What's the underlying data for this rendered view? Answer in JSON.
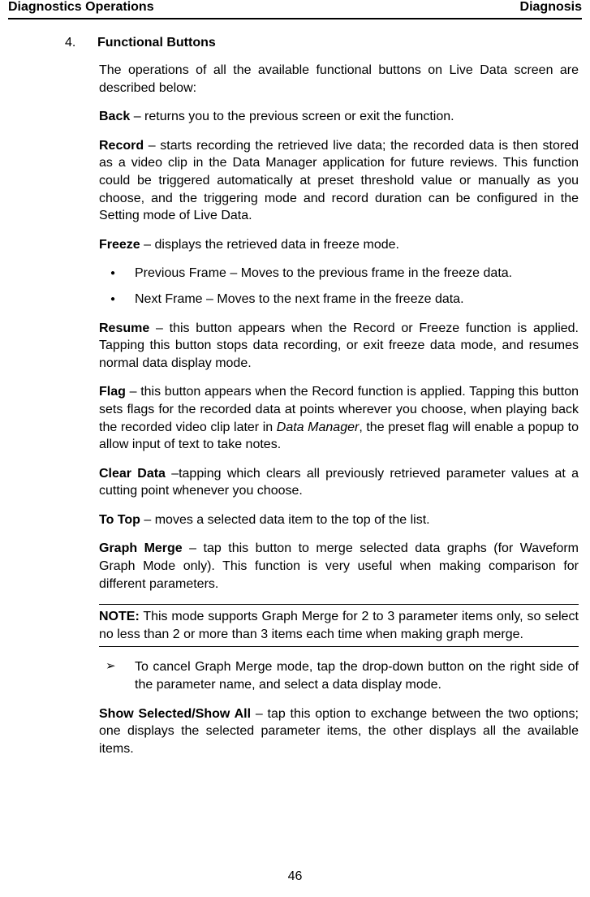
{
  "header": {
    "left": "Diagnostics Operations",
    "right": "Diagnosis"
  },
  "section": {
    "number": "4.",
    "title": "Functional Buttons"
  },
  "intro": "The operations of all the available functional buttons on Live Data screen are described below:",
  "items": {
    "back_label": "Back",
    "back_text": " – returns you to the previous screen or exit the function.",
    "record_label": "Record",
    "record_text": " – starts recording the retrieved live data; the recorded data is then stored as a video clip in the Data Manager application for future reviews. This function could be triggered automatically at preset threshold value or manually as you choose, and the triggering mode and record duration can be configured in the Setting mode of Live Data.",
    "freeze_label": "Freeze",
    "freeze_text": " – displays the retrieved data in freeze mode.",
    "freeze_bullets": [
      "Previous Frame – Moves to the previous frame in the freeze data.",
      "Next Frame – Moves to the next frame in the freeze data."
    ],
    "resume_label": "Resume",
    "resume_text": " – this button appears when the Record or Freeze function is applied. Tapping this button stops data recording, or exit freeze data mode, and resumes normal data display mode.",
    "flag_label": "Flag",
    "flag_text_pre": " – this button appears when the Record function is applied. Tapping this button sets flags for the recorded data at points wherever you choose, when playing back the recorded video clip later in ",
    "flag_text_em": "Data Manager",
    "flag_text_post": ", the preset flag will enable a popup to allow input of text to take notes.",
    "clear_label": "Clear Data",
    "clear_text": " –tapping which clears all previously retrieved parameter values at a cutting point whenever you choose.",
    "totop_label": "To Top",
    "totop_text": " – moves a selected data item to the top of the list.",
    "graph_label": "Graph Merge",
    "graph_text": " – tap this button to merge selected data graphs (for Waveform Graph Mode only). This function is very useful when making comparison for different parameters.",
    "note_label": "NOTE:",
    "note_text": " This mode supports Graph Merge for 2 to 3 parameter items only, so select no less than 2 or more than 3 items each time when making graph merge.",
    "graph_bullets": [
      "To cancel Graph Merge mode, tap the drop-down button on the right side of the parameter name, and select a data display mode."
    ],
    "show_label": "Show Selected/Show All",
    "show_text": " – tap this option to exchange between the two options; one displays the selected parameter items, the other displays all the available items."
  },
  "page_number": "46"
}
